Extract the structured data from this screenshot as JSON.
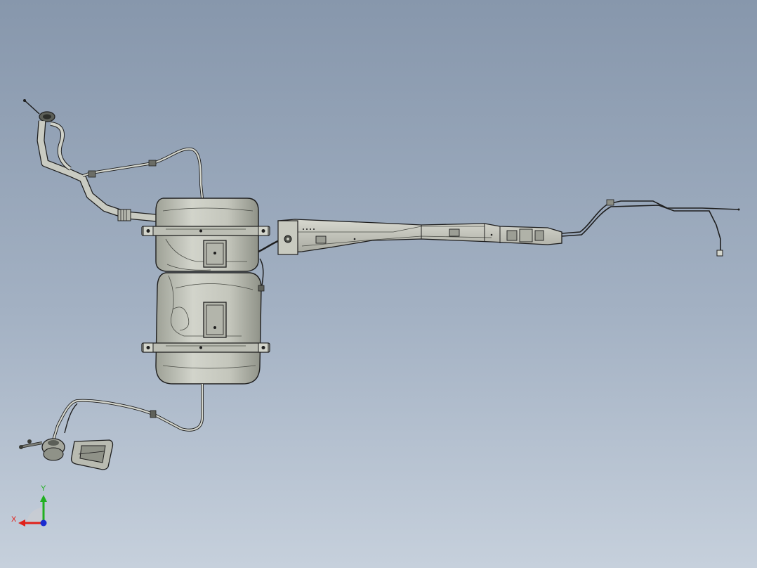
{
  "viewport": {
    "background_top": "#8797ac",
    "background_bottom": "#c6d0dc"
  },
  "model": {
    "part_fill": "#c9cbc2",
    "part_shade": "#9fa298",
    "edge_color": "#1e1e1e"
  },
  "triad": {
    "x_label": "X",
    "y_label": "Y",
    "x_color": "#e0201a",
    "y_color": "#20b020",
    "z_color": "#1a2bd0"
  }
}
